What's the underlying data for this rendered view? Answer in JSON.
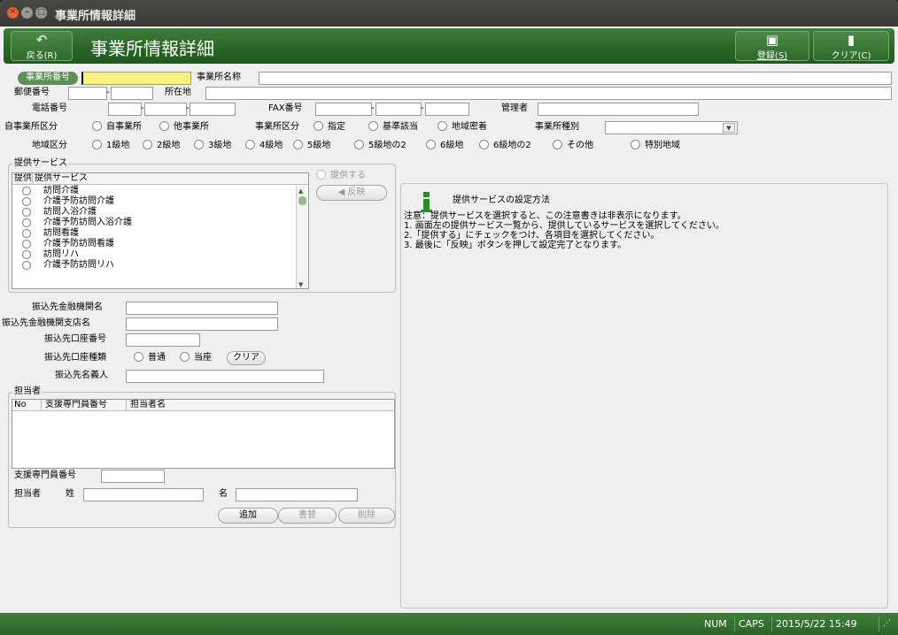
{
  "window": {
    "title": "事業所情報詳細"
  },
  "header": {
    "title": "事業所情報詳細",
    "back_label": "戻る(R)",
    "save_label": "登録(S)",
    "clear_label": "クリア(C)"
  },
  "form": {
    "office_no_label": "事業所番号",
    "office_no_value": "",
    "office_name_label": "事業所名称",
    "postal_label": "郵便番号",
    "address_label": "所在地",
    "phone_label": "電話番号",
    "fax_label": "FAX番号",
    "manager_label": "管理者",
    "office_category_label": "自事業所区分",
    "office_category_options": [
      "自事業所",
      "他事業所"
    ],
    "office_division_label": "事業所区分",
    "office_division_options": [
      "指定",
      "基準該当",
      "地域密着"
    ],
    "office_type_label": "事業所種別",
    "office_type_value": "",
    "region_label": "地域区分",
    "region_options": [
      "1級地",
      "2級地",
      "3級地",
      "4級地",
      "5級地",
      "5級地の2",
      "6級地",
      "6級地の2",
      "その他"
    ],
    "special_region_label": "特別地域"
  },
  "services": {
    "group_title": "提供サービス",
    "columns": [
      "提供",
      "提供サービス"
    ],
    "rows": [
      "訪問介護",
      "介護予防訪問介護",
      "訪問入浴介護",
      "介護予防訪問入浴介護",
      "訪問看護",
      "介護予防訪問看護",
      "訪問リハ",
      "介護予防訪問リハ"
    ],
    "provide_checkbox_label": "提供する",
    "reflect_button_label": "反映"
  },
  "bank": {
    "bank_name_label": "振込先金融機関名",
    "branch_label": "振込先金融機関支店名",
    "account_no_label": "振込先口座番号",
    "account_type_label": "振込先口座種類",
    "account_type_options": [
      "普通",
      "当座"
    ],
    "clear_label": "クリア",
    "holder_label": "振込先名義人"
  },
  "staff": {
    "group_title": "担当者",
    "columns": [
      "No",
      "支援専門員番号",
      "担当者名"
    ],
    "specialist_no_label": "支援専門員番号",
    "staff_label": "担当者",
    "last_name_label": "姓",
    "first_name_label": "名",
    "add_label": "追加",
    "replace_label": "書替",
    "delete_label": "削除"
  },
  "info": {
    "title": "提供サービスの設定方法",
    "lines": [
      "注意：提供サービスを選択すると、この注意書きは非表示になります。",
      "1. 画面左の提供サービス一覧から、提供しているサービスを選択してください。",
      "2.「提供する」にチェックをつけ、各項目を選択してください。",
      "3. 最後に「反映」ボタンを押して設定完了となります。"
    ]
  },
  "status": {
    "num": "NUM",
    "caps": "CAPS",
    "datetime": "2015/5/22 15:49"
  },
  "colors": {
    "accent_green": "#2a6326",
    "office_no_highlight": "#f7f37a"
  },
  "icons": {
    "back": "back-arrow-icon",
    "save": "save-disk-icon",
    "clear": "clear-icon",
    "info": "info-icon"
  }
}
